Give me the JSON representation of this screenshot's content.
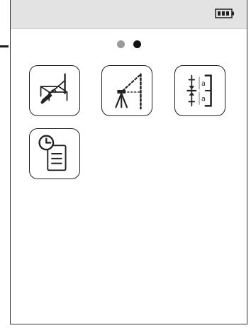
{
  "screen": {
    "name": "measurement-functions-menu",
    "status_bar": {
      "battery_icon": "battery-full-icon",
      "battery_level": 1.0
    },
    "pager": {
      "page_count": 2,
      "active_page": 2,
      "inactive_color": "#9a9a9a",
      "active_color": "#111111"
    },
    "tiles": [
      {
        "id": "inclination",
        "icon": "inclination-measure-icon"
      },
      {
        "id": "indirect-height",
        "icon": "tripod-indirect-height-icon"
      },
      {
        "id": "stakeout",
        "icon": "stakeout-distance-icon"
      },
      {
        "id": "history",
        "icon": "history-clock-list-icon"
      }
    ],
    "stakeout_icon_text": {
      "upper": "a",
      "lower": "a"
    }
  }
}
